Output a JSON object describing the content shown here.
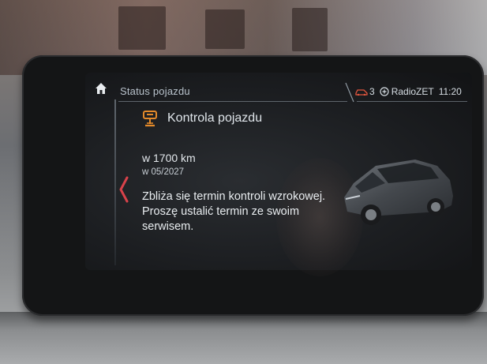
{
  "header": {
    "title": "Status pojazdu"
  },
  "status_bar": {
    "car_count": "3",
    "radio_station": "RadioZET",
    "time": "11:20"
  },
  "content": {
    "section_title": "Kontrola pojazdu",
    "distance": "w 1700 km",
    "date": "w 05/2027",
    "message": "Zbliża się termin kontroli wzrokowej. Proszę ustalić termin ze swoim serwisem."
  },
  "colors": {
    "accent_orange": "#e38a2a",
    "back_chevron_red": "#d8424a",
    "screen_bg": "#1c1e21"
  },
  "icons": {
    "home": "home-icon",
    "car": "car-icon",
    "radio": "radio-icon",
    "inspection": "vehicle-inspection-icon",
    "back": "chevron-left-icon"
  }
}
